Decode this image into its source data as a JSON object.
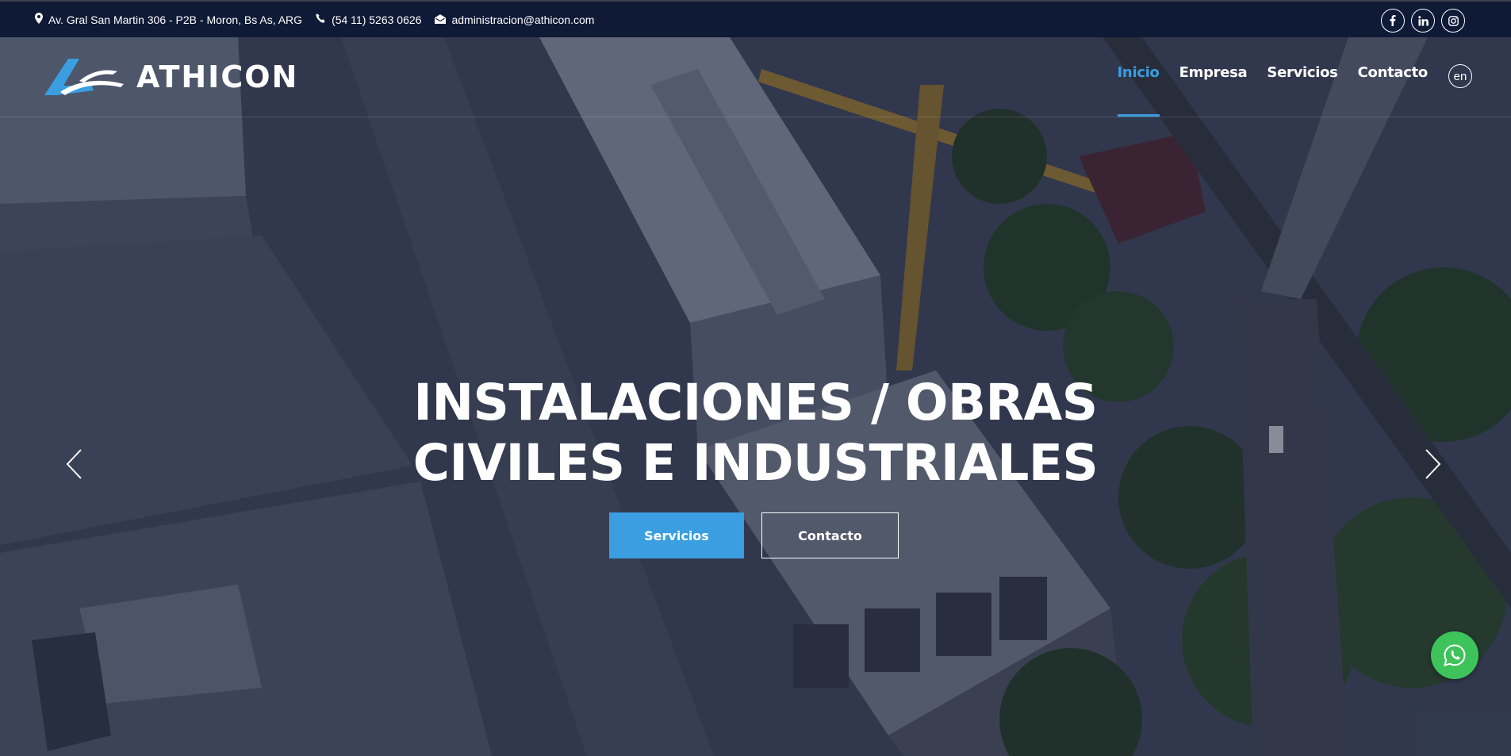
{
  "topbar": {
    "address": "Av. Gral San Martin 306 - P2B - Moron, Bs As, ARG",
    "phone": "(54 11) 5263 0626",
    "email": "administracion@athicon.com",
    "socials": [
      "facebook-icon",
      "linkedin-icon",
      "instagram-icon"
    ]
  },
  "header": {
    "logo_text": "ATHICON",
    "nav": [
      {
        "label": "Inicio",
        "active": true
      },
      {
        "label": "Empresa",
        "active": false
      },
      {
        "label": "Servicios",
        "active": false
      },
      {
        "label": "Contacto",
        "active": false
      }
    ],
    "lang": "en"
  },
  "hero": {
    "title_line1": "INSTALACIONES / OBRAS",
    "title_line2": "CIVILES E INDUSTRIALES",
    "button_primary": "Servicios",
    "button_secondary": "Contacto"
  },
  "colors": {
    "accent": "#3a9ee0",
    "topbar_bg": "#0e1a36",
    "whatsapp": "#3ec35a"
  }
}
